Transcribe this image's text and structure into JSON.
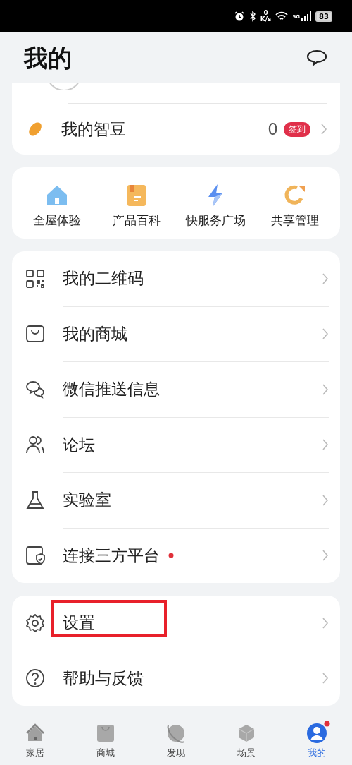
{
  "status_bar": {
    "speed_value": "0",
    "speed_unit": "K/s",
    "network": "5G",
    "battery": "83"
  },
  "header": {
    "title": "我的"
  },
  "beans": {
    "label": "我的智豆",
    "count": "0",
    "badge": "签到"
  },
  "shortcuts": [
    {
      "kind": "house",
      "label": "全屋体验"
    },
    {
      "kind": "book",
      "label": "产品百科"
    },
    {
      "kind": "bolt",
      "label": "快服务广场"
    },
    {
      "kind": "share",
      "label": "共享管理"
    }
  ],
  "menu_groups": [
    [
      {
        "kind": "qr",
        "label": "我的二维码",
        "dot": false,
        "highlighted": false
      },
      {
        "kind": "bag",
        "label": "我的商城",
        "dot": false,
        "highlighted": false
      },
      {
        "kind": "chat",
        "label": "微信推送信息",
        "dot": false,
        "highlighted": false
      },
      {
        "kind": "people",
        "label": "论坛",
        "dot": false,
        "highlighted": false
      },
      {
        "kind": "flask",
        "label": "实验室",
        "dot": false,
        "highlighted": false
      },
      {
        "kind": "shield",
        "label": "连接三方平台",
        "dot": true,
        "highlighted": false
      }
    ],
    [
      {
        "kind": "gear",
        "label": "设置",
        "dot": false,
        "highlighted": true
      },
      {
        "kind": "help",
        "label": "帮助与反馈",
        "dot": false,
        "highlighted": false
      }
    ]
  ],
  "tab_bar": [
    {
      "kind": "home",
      "label": "家居",
      "selected": false,
      "dot": false
    },
    {
      "kind": "bag",
      "label": "商城",
      "selected": false,
      "dot": false
    },
    {
      "kind": "planet",
      "label": "发现",
      "selected": false,
      "dot": false
    },
    {
      "kind": "cube",
      "label": "场景",
      "selected": false,
      "dot": false
    },
    {
      "kind": "person",
      "label": "我的",
      "selected": true,
      "dot": true
    }
  ]
}
